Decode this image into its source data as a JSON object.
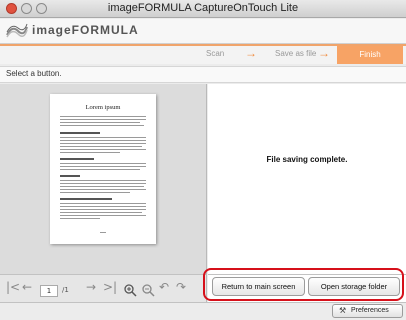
{
  "window": {
    "title": "imageFORMULA CaptureOnTouch Lite"
  },
  "brand": {
    "name": "imageFORMULA",
    "logo_icon": "wave-logo-icon"
  },
  "steps": {
    "scan": "Scan",
    "save": "Save as file",
    "finish": "Finish",
    "arrow": "→"
  },
  "instruction": "Select a button.",
  "preview": {
    "page_heading": "Lorem ipsum"
  },
  "status": {
    "message": "File saving complete."
  },
  "nav": {
    "page_value": "1",
    "page_total": "/1",
    "first": "|<",
    "prev": "←",
    "next": "→",
    "last": ">|",
    "zoom_in": "🔍+",
    "zoom_out": "🔍-",
    "rotate_left": "↶",
    "rotate_right": "↷"
  },
  "actions": {
    "return_main": "Return to main screen",
    "open_storage": "Open storage folder"
  },
  "footer": {
    "preferences": "Preferences"
  },
  "colors": {
    "accent": "#f7a365",
    "highlight": "#d6101a"
  }
}
